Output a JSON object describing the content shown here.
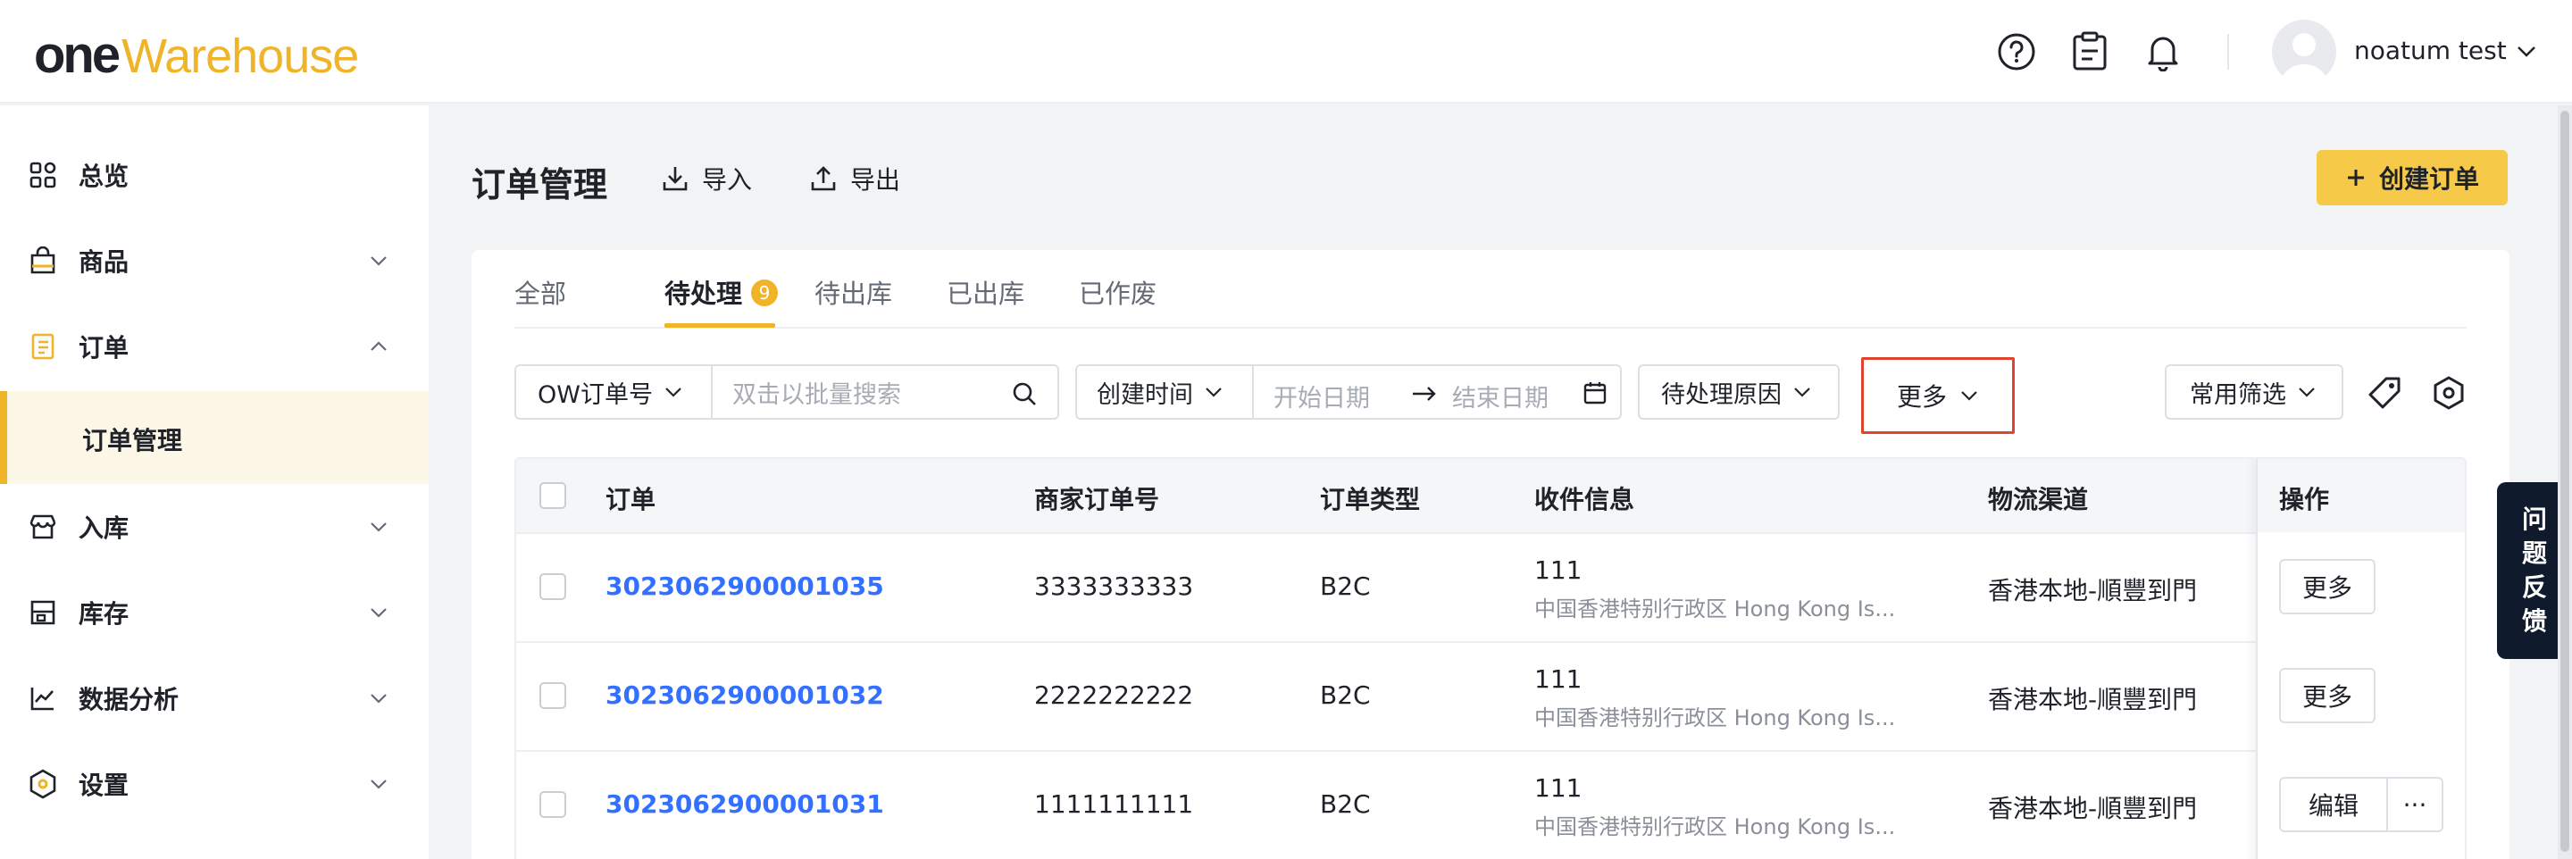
{
  "header": {
    "logo_one": "one",
    "logo_warehouse": "Warehouse",
    "icons": [
      "help-icon",
      "clipboard-icon",
      "bell-icon"
    ],
    "user_name": "noatum test"
  },
  "sidebar": {
    "items": [
      {
        "label": "总览",
        "icon": "overview-grid-icon"
      },
      {
        "label": "商品",
        "icon": "product-bag-icon"
      },
      {
        "label": "订单",
        "icon": "order-list-icon"
      },
      {
        "label": "入库",
        "icon": "inbound-store-icon"
      },
      {
        "label": "库存",
        "icon": "inventory-shelf-icon"
      },
      {
        "label": "数据分析",
        "icon": "chart-line-icon"
      },
      {
        "label": "设置",
        "icon": "settings-hex-icon"
      }
    ],
    "sub_item": "订单管理"
  },
  "main": {
    "title": "订单管理",
    "import_label": "导入",
    "export_label": "导出",
    "create_label": "创建订单",
    "tabs": [
      {
        "label": "全部"
      },
      {
        "label": "待处理",
        "badge": "9"
      },
      {
        "label": "待出库"
      },
      {
        "label": "已出库"
      },
      {
        "label": "已作废"
      }
    ],
    "filters": {
      "order_no_select": "OW订单号",
      "search_placeholder": "双击以批量搜索",
      "time_select": "创建时间",
      "start_date": "开始日期",
      "end_date": "结束日期",
      "reason_select": "待处理原因",
      "more_label": "更多",
      "common_filter": "常用筛选"
    },
    "table": {
      "columns": [
        "订单",
        "商家订单号",
        "订单类型",
        "收件信息",
        "物流渠道",
        "操作"
      ],
      "rows": [
        {
          "order": "3023062900001035",
          "merchant_no": "3333333333",
          "type": "B2C",
          "recipient": "111",
          "address": "中国香港特别行政区 Hong Kong Is...",
          "channel": "香港本地-順豐到門",
          "action": "更多"
        },
        {
          "order": "3023062900001032",
          "merchant_no": "2222222222",
          "type": "B2C",
          "recipient": "111",
          "address": "中国香港特别行政区 Hong Kong Is...",
          "channel": "香港本地-順豐到門",
          "action": "更多"
        },
        {
          "order": "3023062900001031",
          "merchant_no": "1111111111",
          "type": "B2C",
          "recipient": "111",
          "address": "中国香港特别行政区 Hong Kong Is...",
          "channel": "香港本地-順豐到門",
          "action": "编辑",
          "action_more": "···"
        }
      ]
    }
  },
  "feedback": {
    "chars": [
      "问",
      "题",
      "反",
      "馈"
    ]
  },
  "colors": {
    "accent": "#f0b429",
    "button": "#f7c948",
    "link": "#3370ff",
    "highlight": "#e0432e",
    "feedback_bg": "#0f1a2c"
  }
}
